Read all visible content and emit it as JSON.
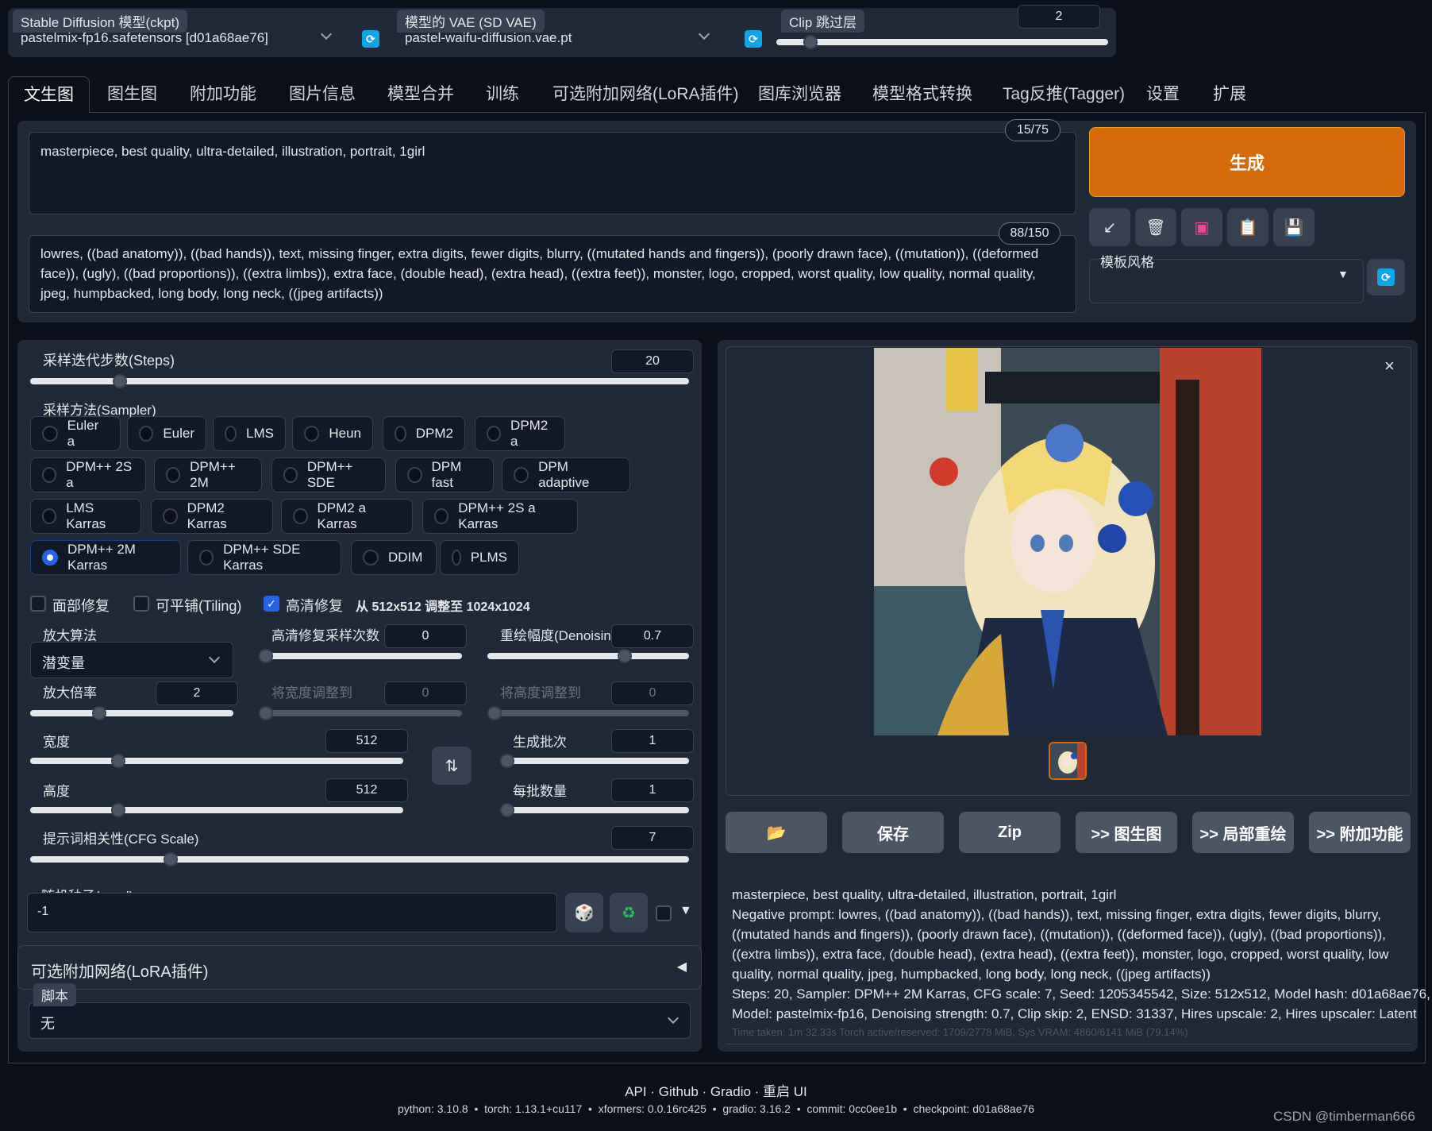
{
  "header": {
    "ckpt_label": "Stable Diffusion 模型(ckpt)",
    "ckpt_value": "pastelmix-fp16.safetensors [d01a68ae76]",
    "vae_label": "模型的 VAE (SD VAE)",
    "vae_value": "pastel-waifu-diffusion.vae.pt",
    "clip_label": "Clip 跳过层",
    "clip_value": "2"
  },
  "tabs": [
    "文生图",
    "图生图",
    "附加功能",
    "图片信息",
    "模型合并",
    "训练",
    "可选附加网络(LoRA插件)",
    "图库浏览器",
    "模型格式转换",
    "Tag反推(Tagger)",
    "设置",
    "扩展"
  ],
  "prompt": {
    "positive": "masterpiece, best quality, ultra-detailed, illustration, portrait, 1girl",
    "positive_count": "15/75",
    "negative": "lowres, ((bad anatomy)), ((bad hands)), text, missing finger, extra digits, fewer digits, blurry, ((mutated hands and fingers)), (poorly drawn face), ((mutation)), ((deformed face)), (ugly), ((bad proportions)), ((extra limbs)), extra face, (double head), (extra head), ((extra feet)), monster, logo, cropped, worst quality, low quality, normal quality, jpeg, humpbacked, long body, long neck, ((jpeg artifacts))",
    "negative_count": "88/150"
  },
  "generate_label": "生成",
  "style_label": "模板风格",
  "steps": {
    "label": "采样迭代步数(Steps)",
    "value": "20"
  },
  "sampler": {
    "label": "采样方法(Sampler)",
    "options": [
      "Euler a",
      "Euler",
      "LMS",
      "Heun",
      "DPM2",
      "DPM2 a",
      "DPM++ 2S a",
      "DPM++ 2M",
      "DPM++ SDE",
      "DPM fast",
      "DPM adaptive",
      "LMS Karras",
      "DPM2 Karras",
      "DPM2 a Karras",
      "DPM++ 2S a Karras",
      "DPM++ 2M Karras",
      "DPM++ SDE Karras",
      "DDIM",
      "PLMS"
    ],
    "selected": "DPM++ 2M Karras"
  },
  "checks": {
    "face": "面部修复",
    "tiling": "可平铺(Tiling)",
    "hires": "高清修复",
    "hires_info": "从 512x512 调整至 1024x1024"
  },
  "hires": {
    "upscaler_label": "放大算法",
    "upscaler_value": "潜变量",
    "steps_label": "高清修复采样次数",
    "steps_value": "0",
    "denoise_label": "重绘幅度(Denoising",
    "denoise_value": "0.7",
    "scale_label": "放大倍率",
    "scale_value": "2",
    "resize_w_label": "将宽度调整到",
    "resize_w_value": "0",
    "resize_h_label": "将高度调整到",
    "resize_h_value": "0"
  },
  "size": {
    "width_label": "宽度",
    "width_value": "512",
    "height_label": "高度",
    "height_value": "512"
  },
  "batch": {
    "count_label": "生成批次",
    "count_value": "1",
    "size_label": "每批数量",
    "size_value": "1"
  },
  "cfg": {
    "label": "提示词相关性(CFG Scale)",
    "value": "7"
  },
  "seed": {
    "label": "随机种子(seed)",
    "value": "-1"
  },
  "lora_label": "可选附加网络(LoRA插件)",
  "script": {
    "label": "脚本",
    "value": "无"
  },
  "output_buttons": [
    "保存",
    "Zip",
    ">> 图生图",
    ">> 局部重绘",
    ">> 附加功能"
  ],
  "info": {
    "line1": "masterpiece, best quality, ultra-detailed, illustration, portrait, 1girl",
    "line2": "Negative prompt: lowres, ((bad anatomy)), ((bad hands)), text, missing finger, extra digits, fewer digits, blurry,",
    "line3": "((mutated hands and fingers)), (poorly drawn face), ((mutation)), ((deformed face)), (ugly), ((bad proportions)),",
    "line4": "((extra limbs)), extra face, (double head), (extra head), ((extra feet)), monster, logo, cropped, worst quality, low",
    "line5": "quality, normal quality, jpeg, humpbacked, long body, long neck, ((jpeg artifacts))",
    "line6": "Steps: 20, Sampler: DPM++ 2M Karras, CFG scale: 7, Seed: 1205345542, Size: 512x512, Model hash: d01a68ae76,",
    "line7": "Model: pastelmix-fp16, Denoising strength: 0.7, Clip skip: 2, ENSD: 31337, Hires upscale: 2, Hires upscaler: Latent",
    "time": "Time taken: 1m 32.33s  Torch active/reserved: 1709/2778 MiB, Sys VRAM: 4860/6141 MiB (79.14%)"
  },
  "footer": {
    "links": "API · Github · Gradio · 重启 UI",
    "versions": "python: 3.10.8  •  torch: 1.13.1+cu117  •  xformers: 0.0.16rc425  •  gradio: 3.16.2  •  commit: 0cc0ee1b  •  checkpoint: d01a68ae76",
    "watermark": "CSDN @timberman666"
  },
  "colors": {
    "accent": "#d56a0a",
    "primary": "#2563eb",
    "refresh": "#0ea5e9"
  }
}
